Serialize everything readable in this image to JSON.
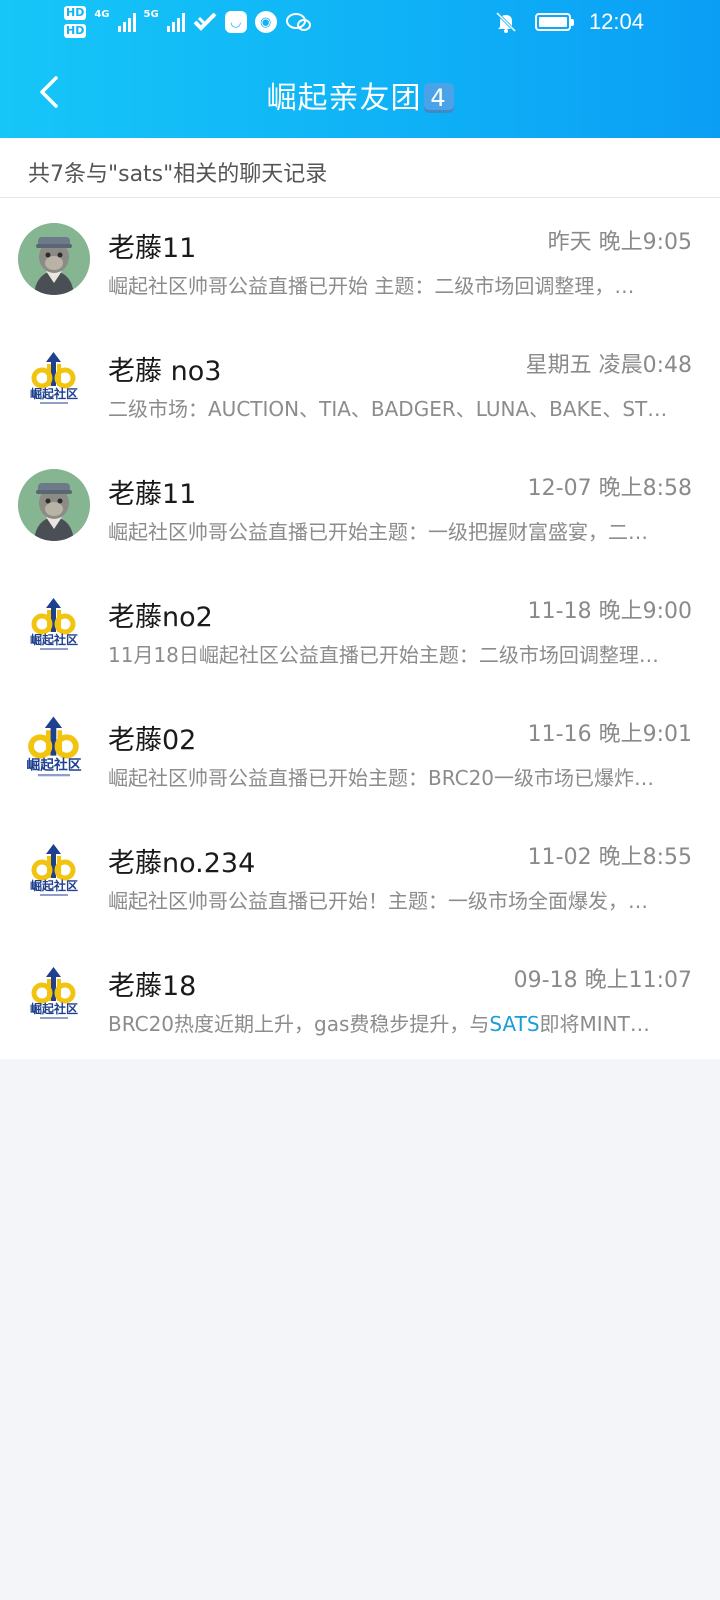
{
  "status_bar": {
    "network_left": "4G",
    "network_right": "5G",
    "time": "12:04"
  },
  "header": {
    "title": "崛起亲友团",
    "title_badge": "4"
  },
  "summary": "共7条与\"sats\"相关的聊天记录",
  "results": [
    {
      "name": "老藤11",
      "time": "昨天 晚上9:05",
      "preview": "崛起社区帅哥公益直播已开始  主题：二级市场回调整理，…",
      "preview_highlight": "",
      "preview_after": "",
      "avatar": "ape"
    },
    {
      "name": "老藤 no3",
      "time": "星期五 凌晨0:48",
      "preview": "二级市场：AUCTION、TIA、BADGER、LUNA、BAKE、ST…",
      "preview_highlight": "",
      "preview_after": "",
      "avatar": "logo"
    },
    {
      "name": "老藤11",
      "time": "12-07 晚上8:58",
      "preview": "崛起社区帅哥公益直播已开始主题：一级把握财富盛宴，二…",
      "preview_highlight": "",
      "preview_after": "",
      "avatar": "ape"
    },
    {
      "name": "老藤no2",
      "time": "11-18 晚上9:00",
      "preview": "11月18日崛起社区公益直播已开始主题：二级市场回调整理…",
      "preview_highlight": "",
      "preview_after": "",
      "avatar": "logo"
    },
    {
      "name": "老藤02",
      "time": "11-16 晚上9:01",
      "preview": "崛起社区帅哥公益直播已开始主题：BRC20一级市场已爆炸…",
      "preview_highlight": "",
      "preview_after": "",
      "avatar": "logo-big"
    },
    {
      "name": "老藤no.234",
      "time": "11-02 晚上8:55",
      "preview": "崛起社区帅哥公益直播已开始！主题：一级市场全面爆发，…",
      "preview_highlight": "",
      "preview_after": "",
      "avatar": "logo"
    },
    {
      "name": "老藤18",
      "time": "09-18 晚上11:07",
      "preview": "BRC20热度近期上升，gas费稳步提升，与",
      "preview_highlight": "SATS",
      "preview_after": "即将MINT…",
      "avatar": "logo"
    }
  ],
  "logo_text": "崛起社区",
  "colors": {
    "header_start": "#16c6f8",
    "header_end": "#0b9ef5",
    "highlight": "#1b9dd6",
    "logo_blue": "#1f3f8f",
    "logo_yellow": "#f2c40f"
  }
}
